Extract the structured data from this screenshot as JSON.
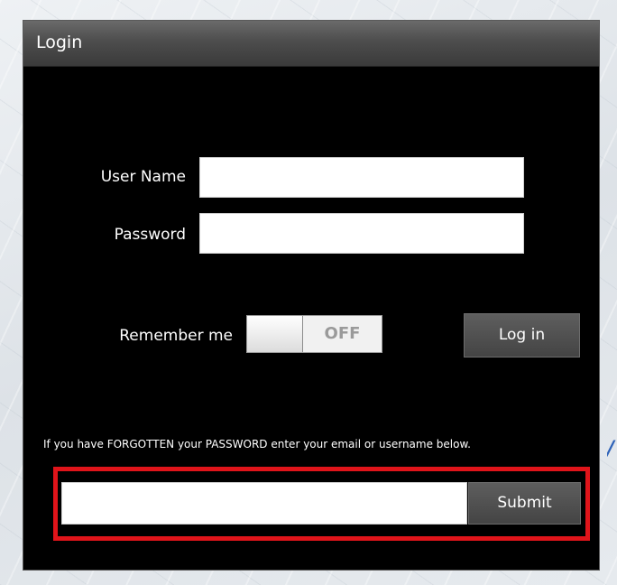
{
  "window": {
    "title": "Login"
  },
  "form": {
    "username_label": "User Name",
    "username_value": "",
    "password_label": "Password",
    "password_value": "",
    "remember_label": "Remember me",
    "remember_state": "OFF",
    "login_button": "Log in"
  },
  "forgot": {
    "instructions": "If you have FORGOTTEN your PASSWORD enter your email or username below.",
    "input_value": "",
    "submit_button": "Submit"
  },
  "colors": {
    "window_bg": "#000000",
    "highlight": "#e0141a",
    "accent_mark": "#2f63b8"
  }
}
